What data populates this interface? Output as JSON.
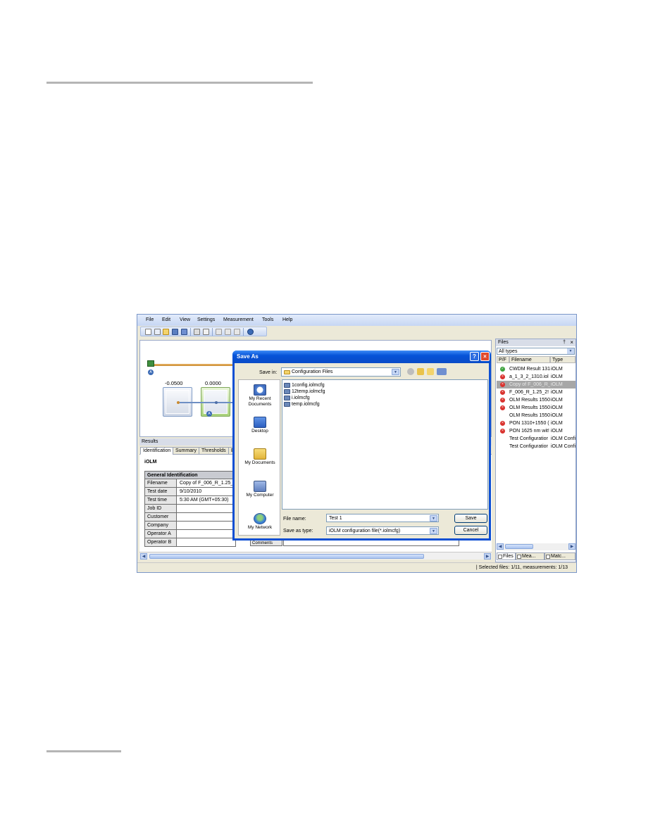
{
  "menu": [
    "File",
    "Edit",
    "View",
    "Settings",
    "Measurement",
    "Tools",
    "Help"
  ],
  "diagram": {
    "value_left": "-0.0500",
    "value_right": "0.0000",
    "marker_label": "A"
  },
  "results": {
    "header": "Results",
    "tabs": [
      "Identification",
      "Summary",
      "Thresholds",
      "E"
    ],
    "title": "iOLM",
    "table_header": "General Identification",
    "rows": [
      {
        "label": "Filename",
        "value": "Copy of F_006_R_1.25_"
      },
      {
        "label": "Test date",
        "value": "9/10/2010"
      },
      {
        "label": "Test time",
        "value": "5:30 AM (GMT+05:30)"
      },
      {
        "label": "Job ID",
        "value": ""
      },
      {
        "label": "Customer",
        "value": ""
      },
      {
        "label": "Company",
        "value": ""
      },
      {
        "label": "Operator A",
        "value": ""
      },
      {
        "label": "Operator B",
        "value": ""
      }
    ],
    "comments_label": "Comments"
  },
  "status": "| Selected files: 1/11, measurements: 1/13",
  "files_panel": {
    "title": "Files",
    "pin": "†",
    "close": "×",
    "filter": "All types",
    "columns": [
      "P/F",
      "Filename",
      "Type"
    ],
    "items": [
      {
        "status": "pass",
        "name": "CWDM Result 131",
        "type": "iOLM"
      },
      {
        "status": "fail",
        "name": "a_1_3_2_1310.iol",
        "type": "iOLM"
      },
      {
        "status": "fail",
        "name": "Copy of F_006_R_",
        "type": "iOLM"
      },
      {
        "status": "fail",
        "name": "F_006_R_1.25_2!",
        "type": "iOLM"
      },
      {
        "status": "fail",
        "name": "OLM Results 1550",
        "type": "iOLM"
      },
      {
        "status": "fail",
        "name": "OLM Results 1550",
        "type": "iOLM"
      },
      {
        "status": "none",
        "name": "OLM Results 1550",
        "type": "iOLM"
      },
      {
        "status": "fail",
        "name": "PON 1310+1550 (",
        "type": "iOLM"
      },
      {
        "status": "fail",
        "name": "PON 1625 nm wit!",
        "type": "iOLM"
      },
      {
        "status": "none",
        "name": "Test Configuratior",
        "type": "iOLM Confi"
      },
      {
        "status": "none",
        "name": "Test Configuratior",
        "type": "iOLM Confi"
      }
    ],
    "tabs": [
      "Files",
      "Mea...",
      "Matc..."
    ]
  },
  "dialog": {
    "title": "Save As",
    "help": "?",
    "close": "×",
    "save_in_label": "Save in:",
    "save_in_value": "Configuration Files",
    "places": [
      "My Recent Documents",
      "Desktop",
      "My Documents",
      "My Computer",
      "My Network"
    ],
    "files": [
      "1config.iolmcfg",
      "12temp.iolmcfg",
      "i.iolmcfg",
      "temp.iolmcfg"
    ],
    "file_name_label": "File name:",
    "file_name_value": "Test 1",
    "save_type_label": "Save as type:",
    "save_type_value": "iOLM configuration file(*.iolmcfg)",
    "save_button": "Save",
    "cancel_button": "Cancel"
  }
}
